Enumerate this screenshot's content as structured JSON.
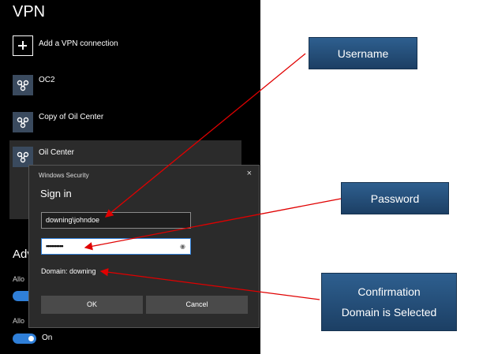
{
  "vpn": {
    "title": "VPN",
    "add_label": "Add a VPN connection",
    "connections": [
      "OC2",
      "Copy of Oil Center",
      "Oil Center"
    ],
    "advanced_partial": "Adv",
    "allow1_partial": "Allo",
    "allow2_partial": "Allo",
    "toggle_state": "On"
  },
  "dialog": {
    "title": "Windows Security",
    "close": "×",
    "heading": "Sign in",
    "username_value": "downing\\johndoe",
    "password_mask": "••••••••••",
    "domain_text": "Domain: downing",
    "ok_label": "OK",
    "cancel_label": "Cancel"
  },
  "callouts": {
    "username": "Username",
    "password": "Password",
    "confirmation_line1": "Confirmation",
    "confirmation_line2": "Domain is Selected"
  },
  "colors": {
    "accent": "#2f7fd8",
    "callout": "#2e5f8f",
    "arrow": "#e00000"
  },
  "icons": {
    "vpn": "vpn-network-icon",
    "add": "plus-icon",
    "reveal": "eye-icon"
  }
}
